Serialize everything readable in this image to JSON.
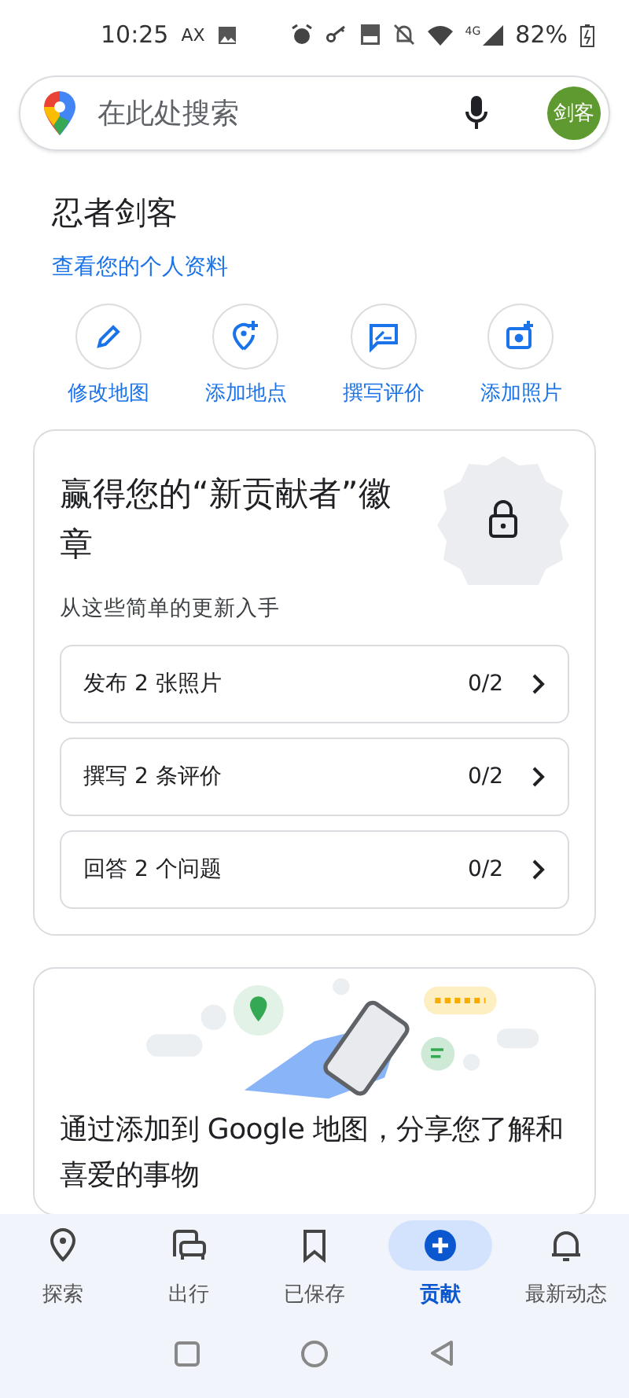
{
  "status_bar": {
    "time": "10:25",
    "carrier": "AX",
    "network": "4G",
    "battery": "82%"
  },
  "search": {
    "placeholder": "在此处搜索",
    "avatar": "剑客"
  },
  "profile": {
    "name": "忍者剑客",
    "link": "查看您的个人资料"
  },
  "actions": [
    {
      "kind": "edit",
      "label": "修改地图"
    },
    {
      "kind": "place",
      "label": "添加地点"
    },
    {
      "kind": "review",
      "label": "撰写评价"
    },
    {
      "kind": "photo",
      "label": "添加照片"
    }
  ],
  "badge_card": {
    "title": "赢得您的“新贡献者”徽章",
    "subtitle": "从这些简单的更新入手",
    "tasks": [
      {
        "label": "发布 2 张照片",
        "count": "0/2"
      },
      {
        "label": "撰写 2 条评价",
        "count": "0/2"
      },
      {
        "label": "回答 2 个问题",
        "count": "0/2"
      }
    ]
  },
  "share_card": {
    "text": "通过添加到 Google 地图，分享您了解和喜爱的事物"
  },
  "bottom_nav": [
    {
      "kind": "explore",
      "label": "探索",
      "selected": false
    },
    {
      "kind": "go",
      "label": "出行",
      "selected": false
    },
    {
      "kind": "saved",
      "label": "已保存",
      "selected": false
    },
    {
      "kind": "contribute",
      "label": "贡献",
      "selected": true
    },
    {
      "kind": "updates",
      "label": "最新动态",
      "selected": false
    }
  ]
}
